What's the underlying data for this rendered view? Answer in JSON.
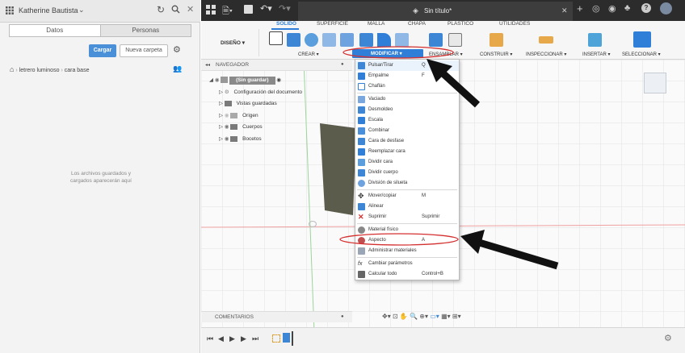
{
  "left_panel": {
    "user_name": "Katherine Bautista",
    "tabs": [
      "Datos",
      "Personas"
    ],
    "upload_label": "Cargar",
    "new_folder_label": "Nueva carpeta",
    "breadcrumb": {
      "project": "letrero luminoso",
      "folder": "cara base"
    },
    "empty_text_1": "Los archivos guardados y",
    "empty_text_2": "cargados aparecerán aquí"
  },
  "app": {
    "doc_title": "Sin título*",
    "tabs": [
      "SÓLIDO",
      "SUPERFICIE",
      "MALLA",
      "CHAPA",
      "PLÁSTICO",
      "UTILIDADES"
    ],
    "workspace": "DISEÑO ▾",
    "groups": [
      "CREAR ▾",
      "MODIFICAR ▾",
      "ENSAMBLAR ▾",
      "CONSTRUIR ▾",
      "INSPECCIONAR ▾",
      "INSERTAR ▾",
      "SELECCIONAR ▾"
    ]
  },
  "navigator": {
    "title": "NAVEGADOR",
    "root": "(Sin guardar)",
    "items": [
      "Configuración del documento",
      "Vistas guardadas",
      "Origen",
      "Cuerpos",
      "Bocetos"
    ]
  },
  "comments_label": "COMENTARIOS",
  "menu": {
    "items": [
      {
        "label": "Pulsar/Tirar",
        "key": "Q"
      },
      {
        "label": "Empalme",
        "key": "F"
      },
      {
        "label": "Chaflán",
        "key": ""
      },
      {
        "label": "Vaciado",
        "key": ""
      },
      {
        "label": "Desmoldeo",
        "key": ""
      },
      {
        "label": "Escala",
        "key": ""
      },
      {
        "label": "Combinar",
        "key": ""
      },
      {
        "label": "Cara de desfase",
        "key": ""
      },
      {
        "label": "Reemplazar cara",
        "key": ""
      },
      {
        "label": "Dividir cara",
        "key": ""
      },
      {
        "label": "Dividir cuerpo",
        "key": ""
      },
      {
        "label": "División de silueta",
        "key": ""
      },
      {
        "label": "Mover/copiar",
        "key": "M"
      },
      {
        "label": "Alinear",
        "key": ""
      },
      {
        "label": "Suprimir",
        "key": "Suprimir"
      },
      {
        "label": "Material físico",
        "key": ""
      },
      {
        "label": "Aspecto",
        "key": "A"
      },
      {
        "label": "Administrar materiales",
        "key": ""
      },
      {
        "label": "Cambiar parámetros",
        "key": ""
      },
      {
        "label": "Calcular todo",
        "key": "Control+B"
      }
    ]
  },
  "colors": {
    "accent": "#2f7fd8",
    "annotation": "#d43030",
    "topbar": "#2c2c2c"
  }
}
